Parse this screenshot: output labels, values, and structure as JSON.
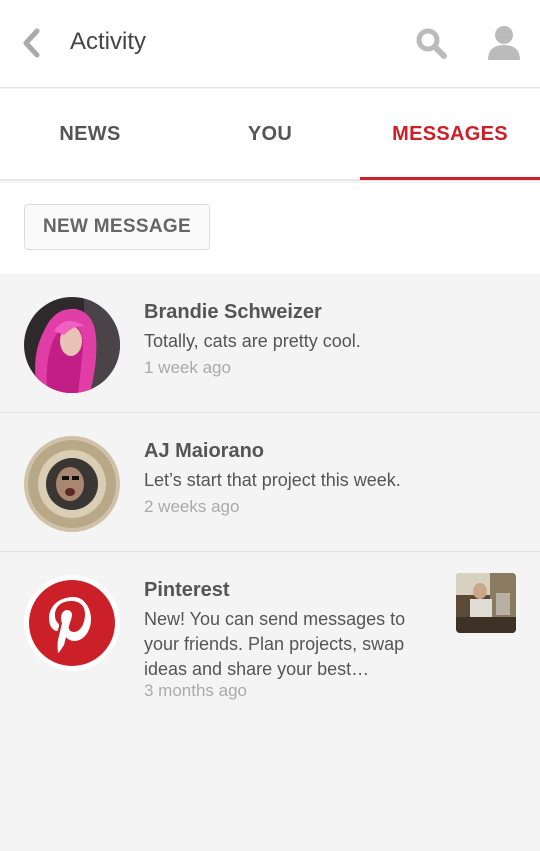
{
  "header": {
    "title": "Activity",
    "back_icon": "chevron-left-icon",
    "search_icon": "search-icon",
    "profile_icon": "user-icon"
  },
  "tabs": [
    {
      "label": "NEWS",
      "active": false
    },
    {
      "label": "YOU",
      "active": false
    },
    {
      "label": "MESSAGES",
      "active": true
    }
  ],
  "new_message_label": "NEW MESSAGE",
  "conversations": [
    {
      "name": "Brandie Schweizer",
      "message": "Totally, cats are pretty cool.",
      "time": "1 week ago"
    },
    {
      "name": "AJ Maiorano",
      "message": "Let’s start that project this week.",
      "time": "2 weeks ago"
    },
    {
      "name": "Pinterest",
      "message": "New! You can send messages to your friends. Plan projects, swap ideas and share your best…",
      "time": "3 months ago",
      "has_thumbnail": true
    }
  ],
  "colors": {
    "accent": "#cb2027",
    "text": "#555555",
    "muted": "#aaaaaa",
    "background": "#f4f4f4"
  }
}
